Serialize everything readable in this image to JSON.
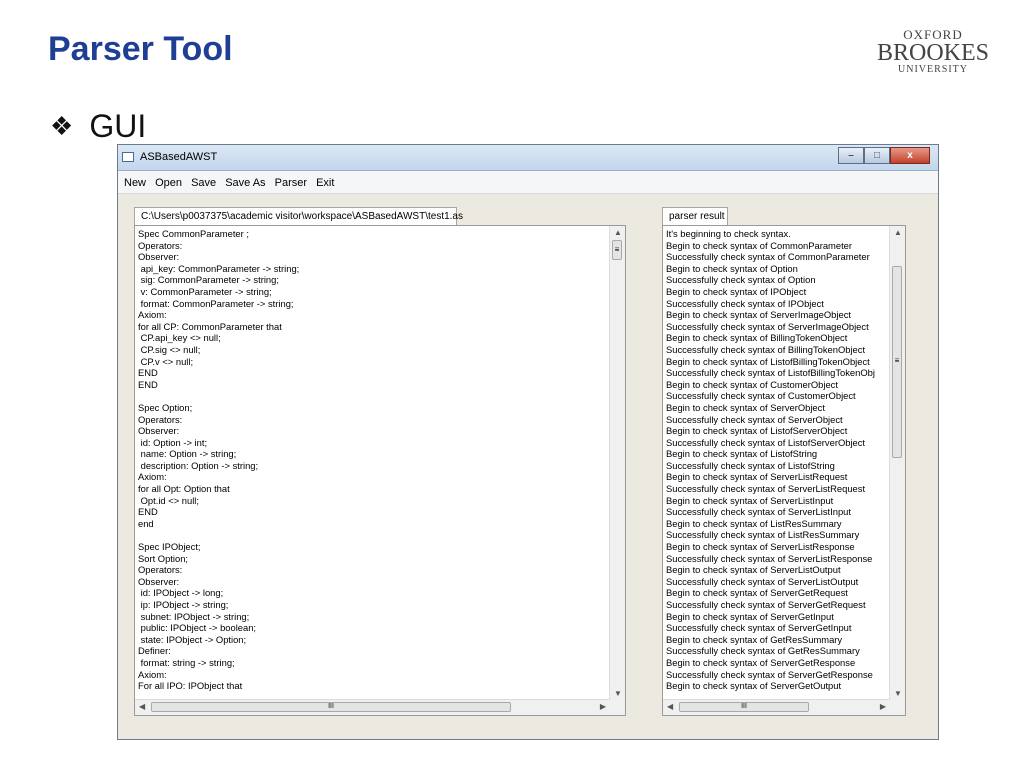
{
  "slide": {
    "title": "Parser Tool",
    "bullet_glyph": "❖",
    "bullet_text": "GUI"
  },
  "logo": {
    "line1": "OXFORD",
    "line2": "BROOKES",
    "line3": "UNIVERSITY"
  },
  "window": {
    "title": "ASBasedAWST",
    "buttons": {
      "minimize": "–",
      "maximize": "□",
      "close": "x"
    }
  },
  "menu": [
    "New",
    "Open",
    "Save",
    "Save As",
    "Parser",
    "Exit"
  ],
  "editor": {
    "tab_label": "C:\\Users\\p0037375\\academic visitor\\workspace\\ASBasedAWST\\test1.as",
    "lines": [
      "Spec CommonParameter ;",
      "Operators:",
      "Observer:",
      " api_key: CommonParameter -> string;",
      " sig: CommonParameter -> string;",
      " v: CommonParameter -> string;",
      " format: CommonParameter -> string;",
      "Axiom:",
      "for all CP: CommonParameter that",
      " CP.api_key <> null;",
      " CP.sig <> null;",
      " CP.v <> null;",
      "END",
      "END",
      "",
      "Spec Option;",
      "Operators:",
      "Observer:",
      " id: Option -> int;",
      " name: Option -> string;",
      " description: Option -> string;",
      "Axiom:",
      "for all Opt: Option that",
      " Opt.id <> null;",
      "END",
      "end",
      "",
      "Spec IPObject;",
      "Sort Option;",
      "Operators:",
      "Observer:",
      " id: IPObject -> long;",
      " ip: IPObject -> string;",
      " subnet: IPObject -> string;",
      " public: IPObject -> boolean;",
      " state: IPObject -> Option;",
      "Definer:",
      " format: string -> string;",
      "Axiom:",
      "For all IPO: IPObject that"
    ]
  },
  "result": {
    "tab_label": "parser result",
    "lines": [
      "It's beginning to check syntax.",
      "Begin to check syntax of CommonParameter",
      "Successfully check syntax of CommonParameter",
      "Begin to check syntax of Option",
      "Successfully check syntax of Option",
      "Begin to check syntax of IPObject",
      "Successfully check syntax of IPObject",
      "Begin to check syntax of ServerImageObject",
      "Successfully check syntax of ServerImageObject",
      "Begin to check syntax of BillingTokenObject",
      "Successfully check syntax of BillingTokenObject",
      "Begin to check syntax of ListofBillingTokenObject",
      "Successfully check syntax of ListofBillingTokenObj",
      "Begin to check syntax of CustomerObject",
      "Successfully check syntax of CustomerObject",
      "Begin to check syntax of ServerObject",
      "Successfully check syntax of ServerObject",
      "Begin to check syntax of ListofServerObject",
      "Successfully check syntax of ListofServerObject",
      "Begin to check syntax of ListofString",
      "Successfully check syntax of ListofString",
      "Begin to check syntax of ServerListRequest",
      "Successfully check syntax of ServerListRequest",
      "Begin to check syntax of ServerListInput",
      "Successfully check syntax of ServerListInput",
      "Begin to check syntax of ListResSummary",
      "Successfully check syntax of ListResSummary",
      "Begin to check syntax of ServerListResponse",
      "Successfully check syntax of ServerListResponse",
      "Begin to check syntax of ServerListOutput",
      "Successfully check syntax of ServerListOutput",
      "Begin to check syntax of ServerGetRequest",
      "Successfully check syntax of ServerGetRequest",
      "Begin to check syntax of ServerGetInput",
      "Successfully check syntax of ServerGetInput",
      "Begin to check syntax of GetResSummary",
      "Successfully check syntax of GetResSummary",
      "Begin to check syntax of ServerGetResponse",
      "Successfully check syntax of ServerGetResponse",
      "Begin to check syntax of ServerGetOutput"
    ]
  },
  "scroll": {
    "up": "▲",
    "down": "▼",
    "left": "◀",
    "right": "▶",
    "grip_v": "≡",
    "grip_h": "III"
  }
}
